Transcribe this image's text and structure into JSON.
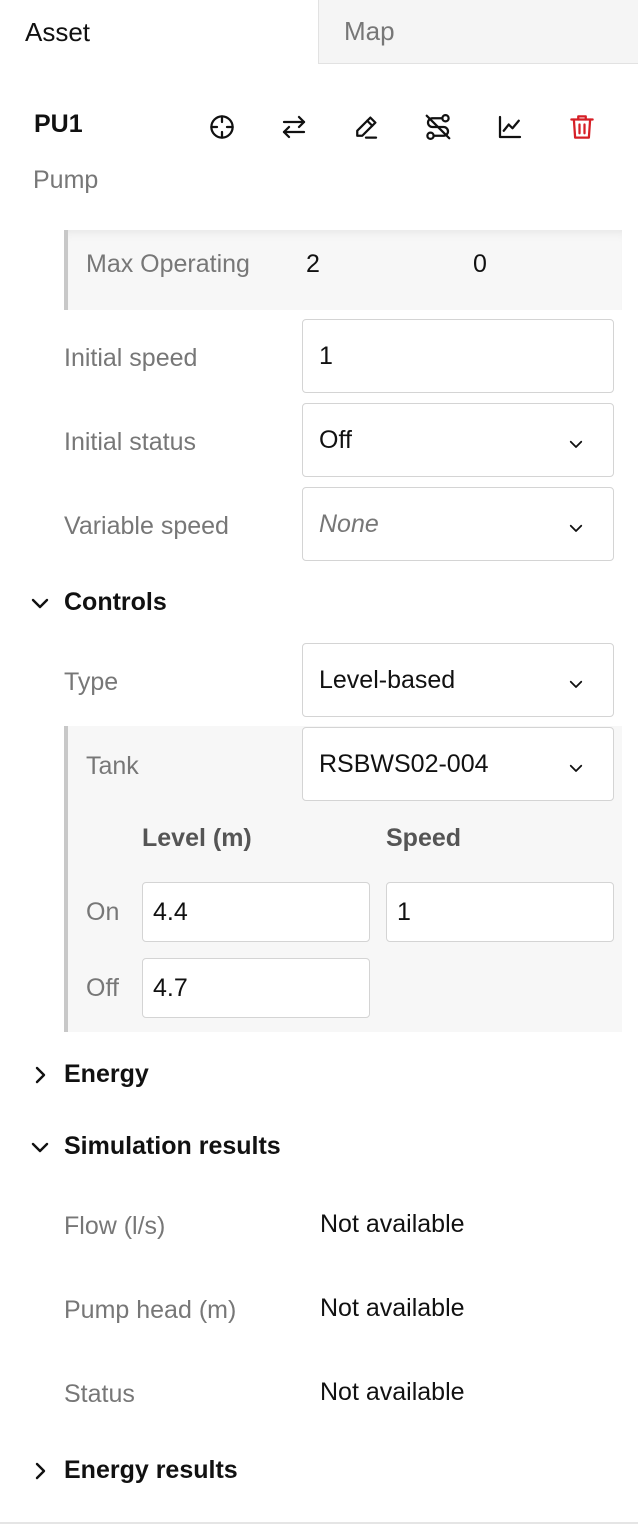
{
  "tabs": [
    {
      "label": "Asset"
    },
    {
      "label": "Map"
    }
  ],
  "asset": {
    "id": "PU1",
    "type": "Pump"
  },
  "toolbar": {
    "icons": [
      "crosshair-icon",
      "swap-icon",
      "pencil-icon",
      "route-icon",
      "chart-icon",
      "trash-icon"
    ],
    "delete_color": "#d61f26"
  },
  "properties": {
    "max_operating": {
      "label": "Max Operating",
      "value_a": "2",
      "value_b": "0"
    },
    "initial_speed": {
      "label": "Initial speed",
      "value": "1"
    },
    "initial_status": {
      "label": "Initial status",
      "value": "Off"
    },
    "variable_speed": {
      "label": "Variable speed",
      "placeholder": "None"
    }
  },
  "controls": {
    "title": "Controls",
    "type_label": "Type",
    "type_value": "Level-based",
    "tank_label": "Tank",
    "tank_value": "RSBWS02-004",
    "level_header": "Level (m)",
    "speed_header": "Speed",
    "on_label": "On",
    "on_level": "4.4",
    "on_speed": "1",
    "off_label": "Off",
    "off_level": "4.7"
  },
  "energy": {
    "title": "Energy"
  },
  "simulation": {
    "title": "Simulation results",
    "rows": [
      {
        "label": "Flow (l/s)",
        "value": "Not available"
      },
      {
        "label": "Pump head (m)",
        "value": "Not available"
      },
      {
        "label": "Status",
        "value": "Not available"
      }
    ]
  },
  "energy_results": {
    "title": "Energy results"
  }
}
